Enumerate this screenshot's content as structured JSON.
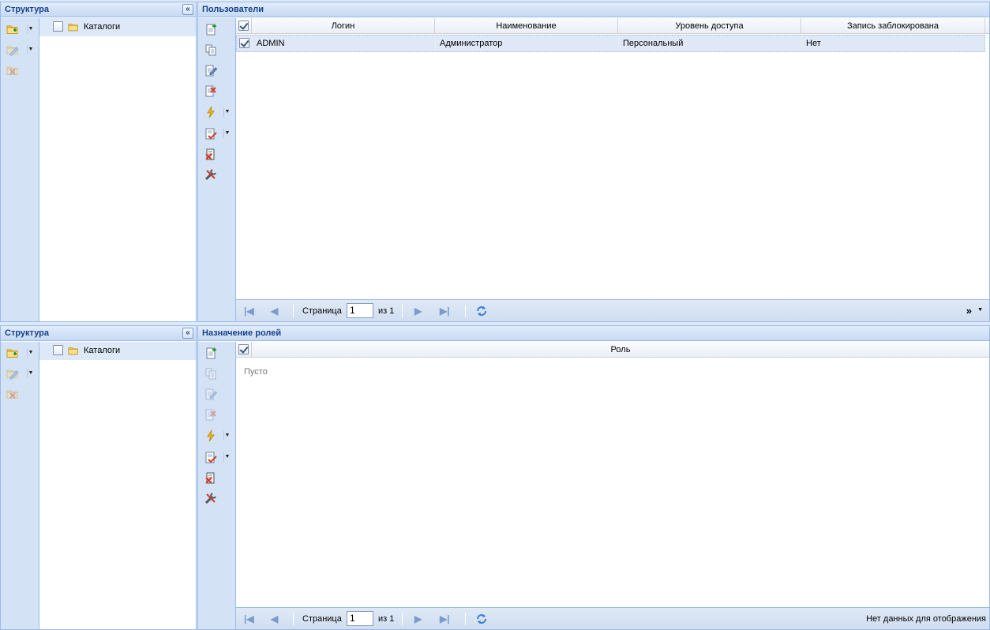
{
  "top": {
    "structure": {
      "title": "Структура",
      "collapse_label": "«",
      "tree": {
        "item_label": "Каталоги"
      }
    },
    "users": {
      "title": "Пользователи",
      "columns": [
        "Логин",
        "Наименование",
        "Уровень доступа",
        "Запись заблокирована"
      ],
      "rows": [
        {
          "login": "ADMIN",
          "name": "Администратор",
          "access": "Персональный",
          "blocked": "Нет"
        }
      ],
      "pager": {
        "page_label": "Страница",
        "page_value": "1",
        "of_label": "из 1",
        "overflow_label": "»"
      }
    }
  },
  "bottom": {
    "structure": {
      "title": "Структура",
      "collapse_label": "«",
      "tree": {
        "item_label": "Каталоги"
      }
    },
    "roles": {
      "title": "Назначение ролей",
      "columns": [
        "Роль"
      ],
      "empty_text": "Пусто",
      "pager": {
        "page_label": "Страница",
        "page_value": "1",
        "of_label": "из 1",
        "status": "Нет данных для отображения"
      }
    }
  },
  "icons": {
    "folder_add": "folder-add-icon",
    "folder_edit": "folder-edit-icon",
    "folder_delete": "folder-delete-icon",
    "add": "add-record-icon",
    "copy": "copy-icon",
    "edit": "edit-icon",
    "delete": "delete-icon",
    "action": "lightning-icon",
    "check": "checklist-icon",
    "clear": "clear-icon",
    "tools": "tools-icon",
    "refresh": "refresh-icon"
  },
  "colors": {
    "header_text": "#15428b",
    "border": "#99bbe8",
    "toolbar_bg": "#d4e2f5",
    "selection": "#dfe8f6"
  }
}
